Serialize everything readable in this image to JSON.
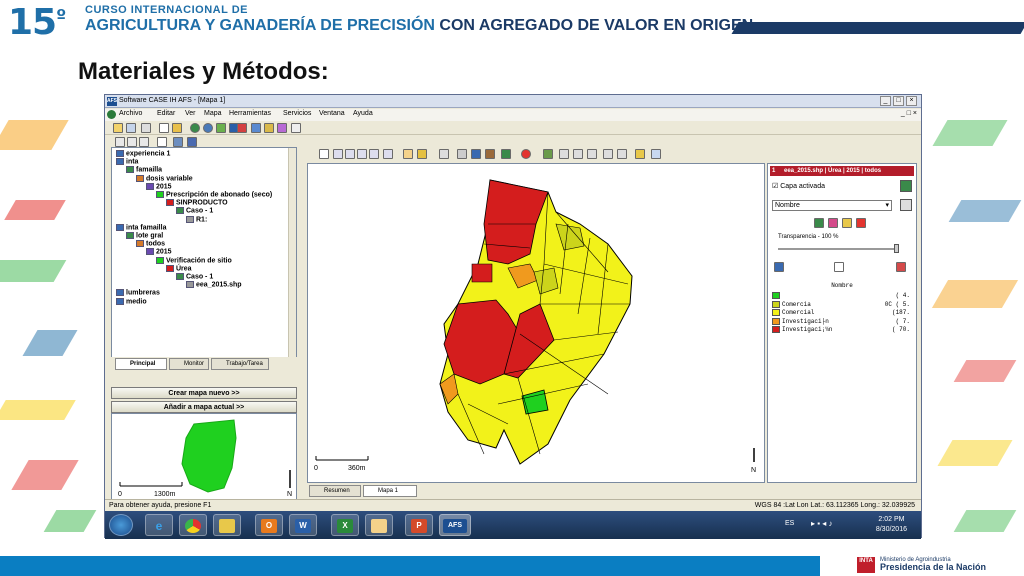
{
  "header": {
    "edition": "15",
    "edition_sup": "º",
    "line1": "CURSO INTERNACIONAL DE",
    "line2a": "AGRICULTURA Y GANADERÍA DE PRECISIÓN",
    "line2b": "CON AGREGADO DE VALOR EN ORIGEN"
  },
  "slide_title": "Materiales y Métodos:",
  "window": {
    "title": "Software CASE IH AFS - [Mapa 1]",
    "logo": "AFS",
    "menu": [
      "Archivo",
      "Editar",
      "Ver",
      "Mapa",
      "Herramientas",
      "Servicios",
      "Ventana",
      "Ayuda"
    ]
  },
  "tree": [
    {
      "label": "experiencia 1",
      "level": 0
    },
    {
      "label": "inta",
      "level": 0
    },
    {
      "label": "famailla",
      "level": 1
    },
    {
      "label": "dosis variable",
      "level": 2
    },
    {
      "label": "2015",
      "level": 3
    },
    {
      "label": "Prescripción de abonado (seco)",
      "level": 4
    },
    {
      "label": "SINPRODUCTO",
      "level": 5
    },
    {
      "label": "Caso - 1",
      "level": 6
    },
    {
      "label": "R1:",
      "level": 7
    },
    {
      "label": "inta famailla",
      "level": 0
    },
    {
      "label": "lote gral",
      "level": 1
    },
    {
      "label": "todos",
      "level": 2
    },
    {
      "label": "2015",
      "level": 3
    },
    {
      "label": "Verificación de sitio",
      "level": 4
    },
    {
      "label": "Úrea",
      "level": 5
    },
    {
      "label": "Caso - 1",
      "level": 6
    },
    {
      "label": "eea_2015.shp",
      "level": 7
    },
    {
      "label": "lumbreras",
      "level": 0
    },
    {
      "label": "medio",
      "level": 0
    }
  ],
  "left_tabs": [
    "Principal",
    "Monitor",
    "Trabajo/Tarea"
  ],
  "buttons": {
    "new_map": "Crear mapa nuevo  >>",
    "add_map": "Añadir a mapa actual  >>"
  },
  "minimap": {
    "scale_start": "0",
    "scale_end": "1300m",
    "north": "N"
  },
  "map": {
    "scale_start": "0",
    "scale_end": "360m",
    "north": "N"
  },
  "map_tabs": [
    "Resumen",
    "Mapa 1"
  ],
  "layer_panel": {
    "index": "1",
    "header": "eea_2015.shp | Úrea | 2015 | todos",
    "checkbox": "Capa activada",
    "dropdown": "Nombre",
    "transparency": "Transparencia - 100 %",
    "legend_title": "Nombre",
    "legend": [
      {
        "label": "",
        "color": "#1fd01f",
        "value": "(  4."
      },
      {
        "label": "Comercia",
        "color": "#ccd41b",
        "value": "0C (  5."
      },
      {
        "label": "Comercial",
        "color": "#f2f21a",
        "value": "(187."
      },
      {
        "label": "Investigaci├n",
        "color": "#f09a1e",
        "value": "(  7."
      },
      {
        "label": "Investigaci¡¼n",
        "color": "#d41d1d",
        "value": "( 70."
      }
    ]
  },
  "status": {
    "help": "Para obtener ayuda, presione F1",
    "coords": "WGS 84 :Lat Lon   Lat.: 63.112365  Long.: 32.039925"
  },
  "taskbar": {
    "lang": "ES",
    "time": "2:02 PM",
    "date": "8/30/2016",
    "apps": [
      "start",
      "ie",
      "chrome",
      "explorer",
      "outlook",
      "word",
      "excel",
      "paint",
      "powerpoint",
      "afs"
    ]
  },
  "footer": {
    "inta": "INTA",
    "ministry": "Ministerio de Agroindustria",
    "presidency": "Presidencia de la Nación"
  },
  "colors": {
    "brand_blue": "#1f6fa8",
    "dark_blue": "#1b3a66",
    "map_red": "#d41d1d",
    "map_yellow": "#f2f21a",
    "map_green": "#1fd01f",
    "map_orange": "#f09a1e"
  }
}
